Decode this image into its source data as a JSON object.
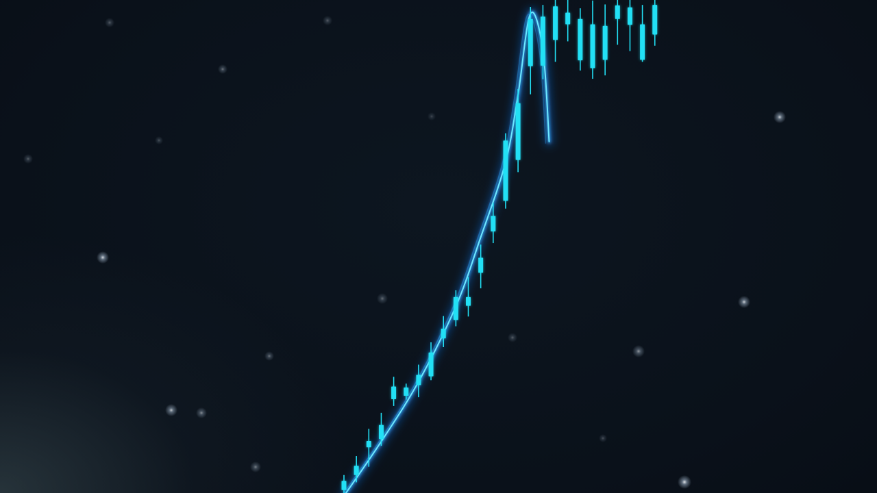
{
  "chart_data": {
    "type": "candlestick",
    "title": "",
    "xlabel": "",
    "ylabel": "",
    "grid": false,
    "legend": "none",
    "ylim": [
      0,
      100
    ],
    "colors": {
      "candle": "#22e0f5",
      "trend_line": "#2aa8ff",
      "trend_glow": "#1f7dff",
      "background": "#0b121b",
      "particle": "#ffffff"
    },
    "series": [
      {
        "type": "candlestick",
        "candles": [
          {
            "x": 0,
            "open": 0.6,
            "close": 2.5,
            "high": 3.7,
            "low": -0.6
          },
          {
            "x": 1,
            "open": 3.7,
            "close": 5.6,
            "high": 7.6,
            "low": 2.2
          },
          {
            "x": 2,
            "open": 9.4,
            "close": 10.7,
            "high": 13.2,
            "low": 5.4
          },
          {
            "x": 3,
            "open": 11.1,
            "close": 14.0,
            "high": 16.5,
            "low": 9.7
          },
          {
            "x": 4,
            "open": 19.3,
            "close": 21.9,
            "high": 23.9,
            "low": 17.9
          },
          {
            "x": 5,
            "open": 20.0,
            "close": 21.7,
            "high": 22.5,
            "low": 19.2
          },
          {
            "x": 6,
            "open": 22.2,
            "close": 24.3,
            "high": 26.4,
            "low": 19.7
          },
          {
            "x": 7,
            "open": 24.0,
            "close": 28.9,
            "high": 31.0,
            "low": 23.2
          },
          {
            "x": 8,
            "open": 31.8,
            "close": 33.8,
            "high": 36.4,
            "low": 30.0
          },
          {
            "x": 9,
            "open": 35.6,
            "close": 40.3,
            "high": 41.7,
            "low": 34.3
          },
          {
            "x": 10,
            "open": 38.5,
            "close": 40.3,
            "high": 44.4,
            "low": 36.3
          },
          {
            "x": 11,
            "open": 45.3,
            "close": 48.4,
            "high": 51.1,
            "low": 42.1
          },
          {
            "x": 12,
            "open": 53.8,
            "close": 57.0,
            "high": 59.7,
            "low": 51.4
          },
          {
            "x": 13,
            "open": 60.1,
            "close": 72.5,
            "high": 74.0,
            "low": 58.5
          },
          {
            "x": 14,
            "open": 68.5,
            "close": 80.2,
            "high": 83.1,
            "low": 66.0
          },
          {
            "x": 15,
            "open": 87.8,
            "close": 97.5,
            "high": 100.0,
            "low": 82.0
          },
          {
            "x": 16,
            "open": 87.9,
            "close": 98.0,
            "high": 100.4,
            "low": 85.1
          },
          {
            "x": 17,
            "open": 93.2,
            "close": 100.1,
            "high": 102.3,
            "low": 88.7
          },
          {
            "x": 18,
            "open": 96.4,
            "close": 98.8,
            "high": 103.7,
            "low": 92.9
          },
          {
            "x": 19,
            "open": 89.0,
            "close": 97.5,
            "high": 99.7,
            "low": 86.9
          },
          {
            "x": 20,
            "open": 87.4,
            "close": 96.4,
            "high": 101.3,
            "low": 85.2
          },
          {
            "x": 21,
            "open": 89.1,
            "close": 96.1,
            "high": 100.5,
            "low": 85.9
          },
          {
            "x": 22,
            "open": 97.5,
            "close": 100.3,
            "high": 102.3,
            "low": 92.2
          },
          {
            "x": 23,
            "open": 96.3,
            "close": 99.9,
            "high": 102.8,
            "low": 90.9
          },
          {
            "x": 24,
            "open": 89.1,
            "close": 96.4,
            "high": 100.4,
            "low": 88.7
          },
          {
            "x": 25,
            "open": 94.3,
            "close": 100.4,
            "high": 103.4,
            "low": 92.0
          }
        ]
      },
      {
        "type": "line",
        "x": [
          0,
          3,
          6,
          9,
          11,
          13,
          14,
          15,
          16,
          16.5
        ],
        "y": [
          -0.6,
          10.6,
          22.9,
          38.4,
          52.6,
          68.1,
          81.9,
          98.6,
          91.1,
          72.3
        ]
      }
    ]
  }
}
